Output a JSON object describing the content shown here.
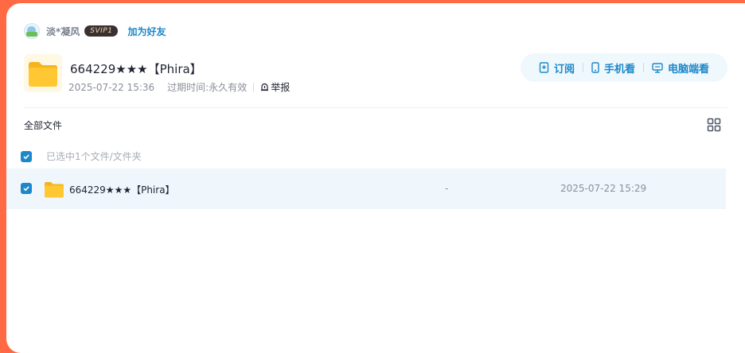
{
  "user": {
    "name": "淡*凝风",
    "vip_badge": "SVIP1",
    "add_friend_label": "加为好友"
  },
  "share": {
    "title": "664229★★★【Phira】",
    "date": "2025-07-22 15:36",
    "expiry_label": "过期时间:",
    "expiry_value": "永久有效",
    "report_label": "举报"
  },
  "actions": {
    "subscribe_label": "订阅",
    "mobile_label": "手机看",
    "pc_label": "电脑端看"
  },
  "breadcrumb": {
    "all_files_label": "全部文件"
  },
  "selection": {
    "summary_text": "已选中1个文件/文件夹",
    "checked": true
  },
  "files": [
    {
      "name": "664229★★★【Phira】",
      "size": "-",
      "modified": "2025-07-22 15:29",
      "checked": true
    }
  ],
  "colors": {
    "accent": "#1d87c9",
    "background": "#ff6a45",
    "folder": "#ffc833"
  },
  "icons": [
    "subscribe-icon",
    "phone-icon",
    "monitor-icon",
    "grid-view-icon",
    "folder-icon",
    "report-icon",
    "checkbox-icon"
  ]
}
